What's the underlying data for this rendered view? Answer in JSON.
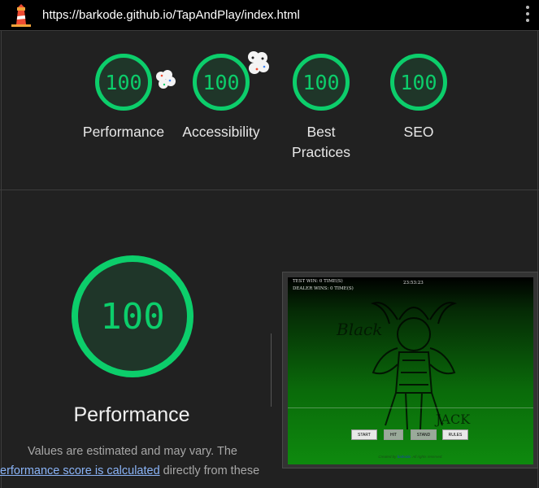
{
  "header": {
    "url": "https://barkode.github.io/TapAndPlay/index.html"
  },
  "gauges": [
    {
      "score": "100",
      "label": "Performance"
    },
    {
      "score": "100",
      "label": "Accessibility"
    },
    {
      "score": "100",
      "label": "Best Practices"
    },
    {
      "score": "100",
      "label": "SEO"
    }
  ],
  "performance": {
    "score": "100",
    "title": "Performance",
    "desc_line1": "Values are estimated and may vary. The",
    "desc_link": "erformance score is calculated",
    "desc_line2_rest": " directly from these"
  },
  "thumbnail": {
    "test_wins": "TEST WIN: 0 TIME(S)",
    "dealer_wins": "DEALER WINS: 0 TIME(S)",
    "clock": "23:53:23",
    "word_black": "Black",
    "word_jack": "JACK",
    "buttons": [
      "START",
      "HIT",
      "STAND",
      "RULES"
    ],
    "footer_prefix": "Created by ",
    "footer_link": "barkode",
    "footer_suffix": ". All rights reserved."
  },
  "colors": {
    "pass": "#0cce6b",
    "background": "#212121",
    "link": "#8ab4f8"
  }
}
